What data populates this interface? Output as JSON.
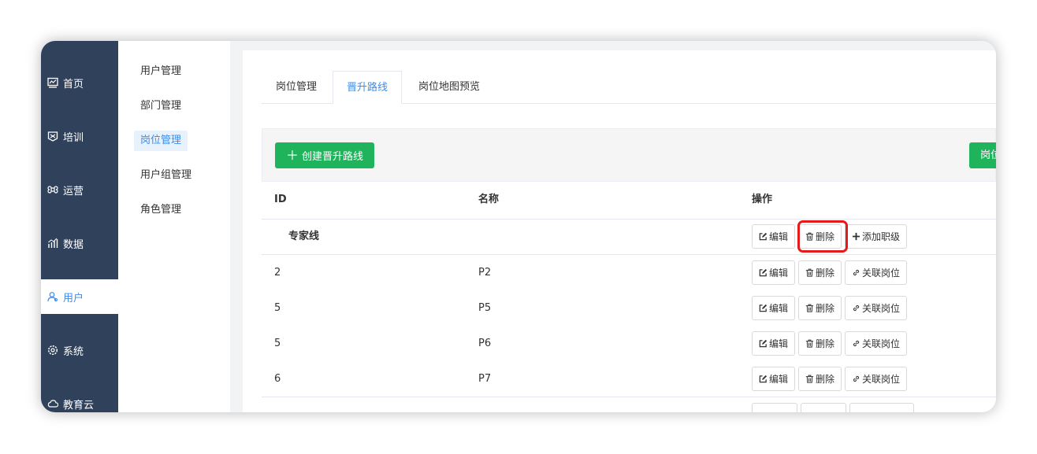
{
  "sidebar": {
    "items": [
      {
        "label": "首页",
        "icon": "dashboard-icon"
      },
      {
        "label": "培训",
        "icon": "training-icon"
      },
      {
        "label": "运营",
        "icon": "command-icon"
      },
      {
        "label": "数据",
        "icon": "chart-icon"
      },
      {
        "label": "用户",
        "icon": "user-icon",
        "active": true
      },
      {
        "label": "系统",
        "icon": "gear-icon"
      },
      {
        "label": "教育云",
        "icon": "cloud-icon"
      }
    ]
  },
  "subnav": {
    "items": [
      {
        "label": "用户管理"
      },
      {
        "label": "部门管理"
      },
      {
        "label": "岗位管理",
        "active": true
      },
      {
        "label": "用户组管理"
      },
      {
        "label": "角色管理"
      }
    ]
  },
  "tabs": [
    {
      "label": "岗位管理"
    },
    {
      "label": "晋升路线",
      "active": true
    },
    {
      "label": "岗位地图预览"
    }
  ],
  "toolbar": {
    "create_label": "创建晋升路线",
    "right_label": "岗位"
  },
  "table": {
    "headers": {
      "id": "ID",
      "name": "名称",
      "ops": "操作"
    },
    "group": {
      "name": "专家线",
      "edit": "编辑",
      "delete": "删除",
      "add": "添加职级"
    },
    "rows": [
      {
        "id": "2",
        "name": "P2"
      },
      {
        "id": "5",
        "name": "P5"
      },
      {
        "id": "5",
        "name": "P6"
      },
      {
        "id": "6",
        "name": "P7"
      }
    ],
    "row_ops": {
      "edit": "编辑",
      "delete": "删除",
      "link": "关联岗位"
    }
  },
  "colors": {
    "sidebar": "#30425b",
    "accent": "#3b8cef",
    "primary_button": "#1fb35b",
    "highlight": "#e51a1a"
  }
}
